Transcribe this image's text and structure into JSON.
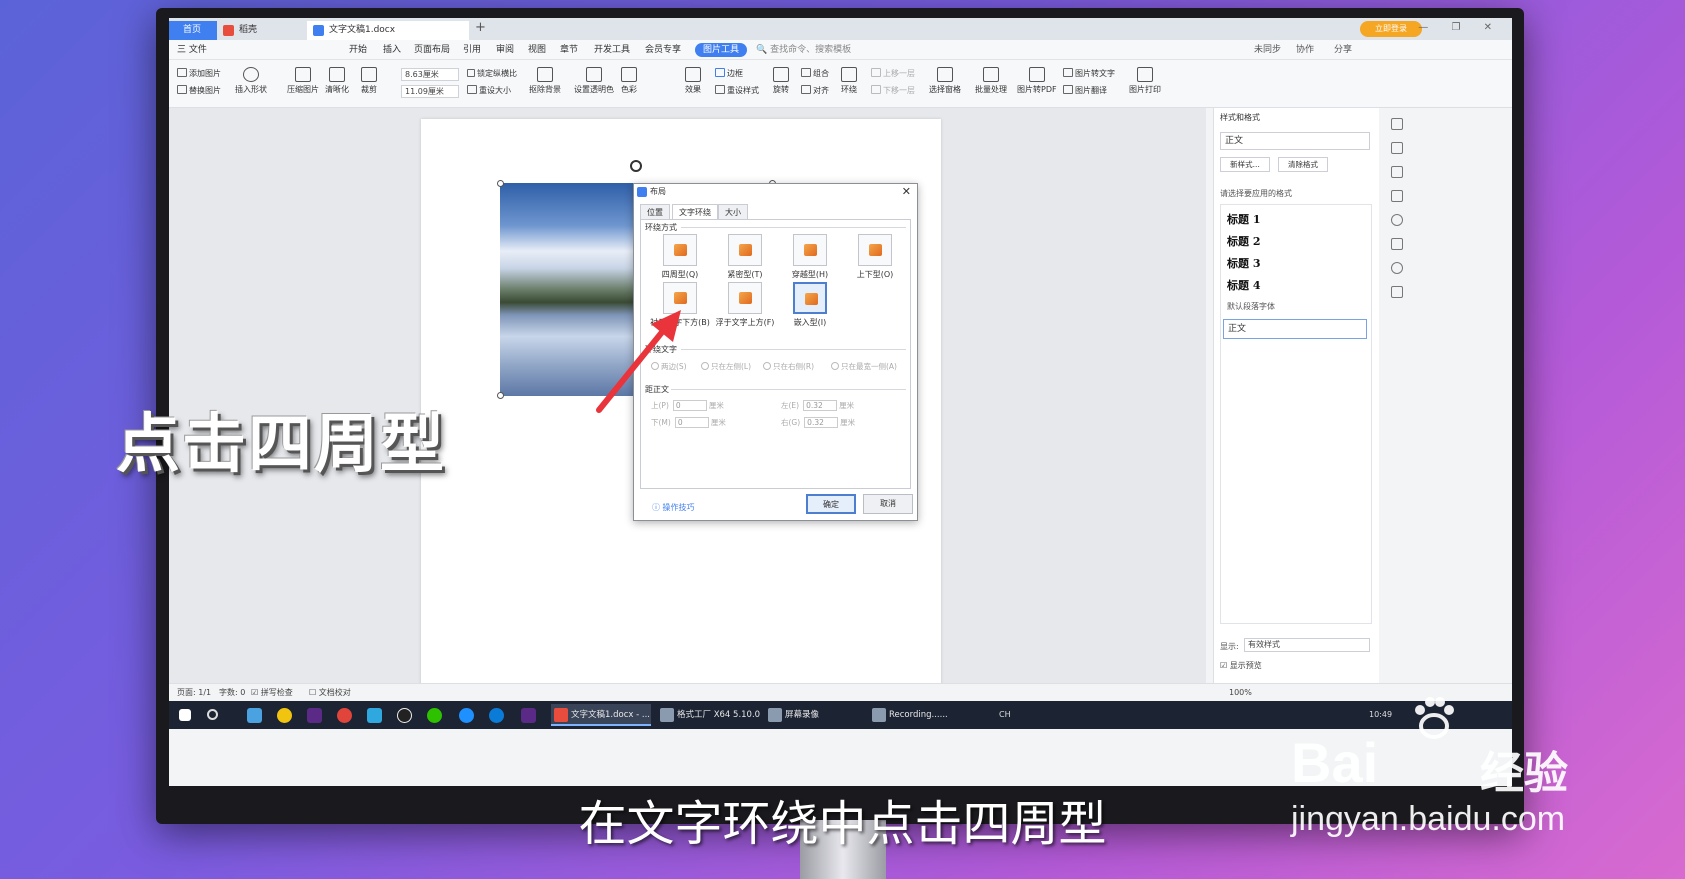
{
  "app": {
    "tabs": [
      {
        "label": "首页"
      },
      {
        "label": "稻壳"
      },
      {
        "label": "文字文稿1.docx"
      }
    ],
    "login_label": "立即登录",
    "menus": [
      "三 文件",
      "开始",
      "插入",
      "页面布局",
      "引用",
      "审阅",
      "视图",
      "章节",
      "开发工具",
      "会员专享",
      "图片工具"
    ],
    "search_hint": "查找命令、搜索模板",
    "right_menus": [
      "未同步",
      "协作",
      "分享"
    ]
  },
  "ribbon": {
    "add_image": "添加图片",
    "replace_image": "替换图片",
    "insert_shape": "插入形状",
    "compress": "压缩图片",
    "clarify": "清晰化",
    "crop": "裁剪",
    "width": "8.63厘米",
    "height": "11.09厘米",
    "lock_ratio": "锁定纵横比",
    "reset_size": "重设大小",
    "remove_bg": "抠除背景",
    "set_transparent": "设置透明色",
    "color": "色彩",
    "effect": "效果",
    "border": "边框",
    "reset_style": "重设样式",
    "rotate": "旋转",
    "combine": "组合",
    "align": "对齐",
    "wrap": "环绕",
    "up_layer": "上移一层",
    "down_layer": "下移一层",
    "select_pane": "选择窗格",
    "batch": "批量处理",
    "to_pdf": "图片转PDF",
    "to_text": "图片转文字",
    "translate": "图片翻译",
    "print": "图片打印"
  },
  "dialog": {
    "title": "布局",
    "tabs": [
      "位置",
      "文字环绕",
      "大小"
    ],
    "wrap_section": "环绕方式",
    "wrap_options": [
      {
        "label": "四周型(Q)"
      },
      {
        "label": "紧密型(T)"
      },
      {
        "label": "穿越型(H)"
      },
      {
        "label": "上下型(O)"
      },
      {
        "label": "衬于文字下方(B)"
      },
      {
        "label": "浮于文字上方(F)"
      },
      {
        "label": "嵌入型(I)"
      }
    ],
    "text_section": "环绕文字",
    "text_options": [
      "两边(S)",
      "只在左侧(L)",
      "只在右侧(R)",
      "只在最宽一侧(A)"
    ],
    "distance_section": "距正文",
    "dist": {
      "top_label": "上(P)",
      "top_val": "0",
      "top_unit": "厘米",
      "bottom_label": "下(M)",
      "bottom_val": "0",
      "bottom_unit": "厘米",
      "left_label": "左(E)",
      "left_val": "0.32",
      "left_unit": "厘米",
      "right_label": "右(G)",
      "right_val": "0.32",
      "right_unit": "厘米"
    },
    "tips": "操作技巧",
    "ok": "确定",
    "cancel": "取消"
  },
  "pane": {
    "title": "样式和格式",
    "current_style": "正文",
    "new_style": "新样式...",
    "clear_format": "清除格式",
    "hint": "请选择要应用的格式",
    "styles": [
      "标题 1",
      "标题 2",
      "标题 3",
      "标题 4"
    ],
    "default_font": "默认段落字体",
    "current": "正文",
    "show_label": "显示:",
    "show_value": "有效样式",
    "preview": "显示预览"
  },
  "status": {
    "page": "页面: 1/1",
    "words": "字数: 0",
    "spell": "拼写检查",
    "proof": "文档校对",
    "zoom": "100%"
  },
  "taskbar": {
    "apps": [
      {
        "label": "文字文稿1.docx - ..."
      },
      {
        "label": "格式工厂 X64 5.10.0"
      },
      {
        "label": "屏幕录像"
      },
      {
        "label": "Recording......"
      }
    ],
    "lang": "CH",
    "time": "10:49"
  },
  "overlay": {
    "title": "点击四周型",
    "subtitle": "在文字环绕中点击四周型"
  },
  "watermark": {
    "brand": "Bai",
    "brand2": "经验",
    "url": "jingyan.baidu.com"
  },
  "colors": {
    "accent": "#3f7ff0",
    "arrow": "#e8343a"
  }
}
